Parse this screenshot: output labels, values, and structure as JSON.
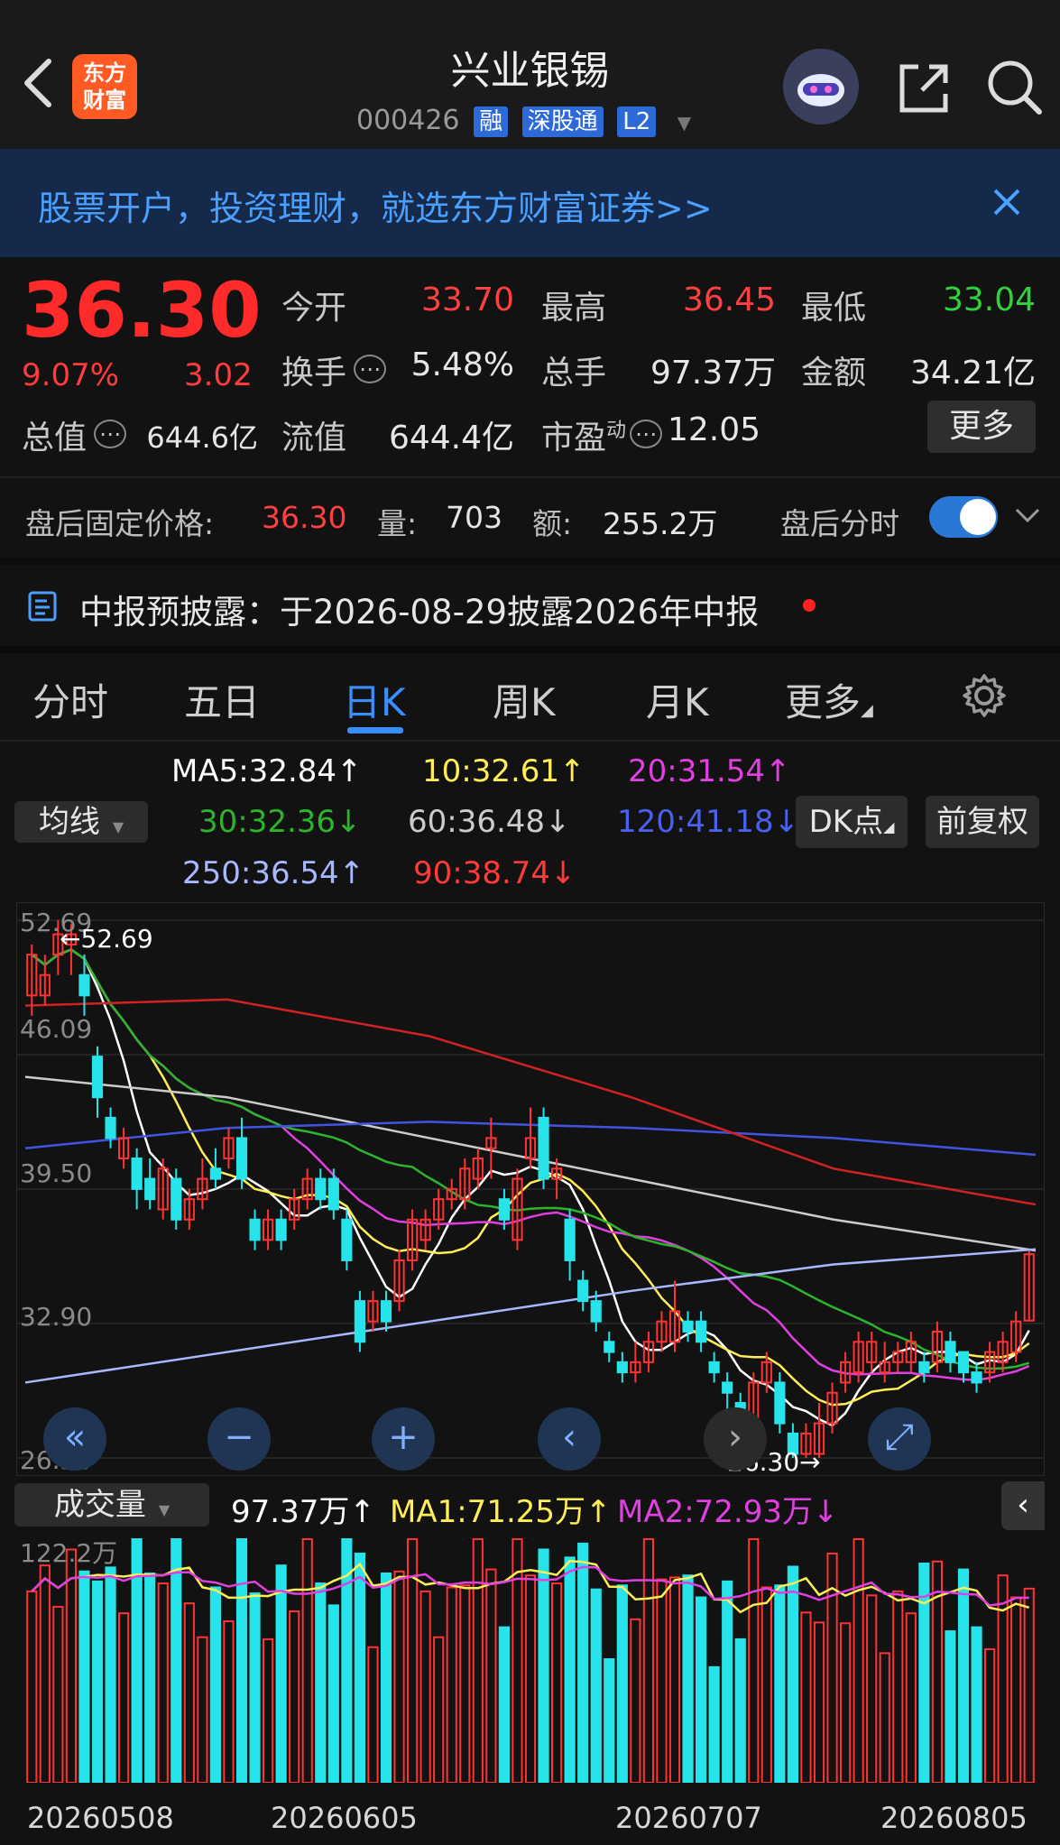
{
  "header": {
    "title": "兴业银锡",
    "code": "000426",
    "tags": [
      "融",
      "深股通",
      "L2"
    ],
    "logo_line1": "东方",
    "logo_line2": "财富"
  },
  "banner": {
    "text": "股票开户，投资理财，就选东方财富证券>>"
  },
  "quote": {
    "price": "36.30",
    "change_pct": "9.07%",
    "change": "3.02",
    "open_label": "今开",
    "open": "33.70",
    "high_label": "最高",
    "high": "36.45",
    "low_label": "最低",
    "low": "33.04",
    "turnover_label": "换手",
    "turnover": "5.48%",
    "volume_label": "总手",
    "volume": "97.37万",
    "amount_label": "金额",
    "amount": "34.21亿",
    "total_cap_label": "总值",
    "total_cap": "644.6亿",
    "float_cap_label": "流值",
    "float_cap": "644.4亿",
    "pe_label": "市盈",
    "pe_sup": "动",
    "pe": "12.05",
    "more": "更多"
  },
  "after_hours": {
    "price_label": "盘后固定价格:",
    "price": "36.30",
    "vol_label": "量:",
    "vol": "703",
    "amt_label": "额:",
    "amt": "255.2万",
    "toggle_label": "盘后分时"
  },
  "notice": {
    "text": "中报预披露：于2026-08-29披露2026年中报"
  },
  "tabs": [
    "分时",
    "五日",
    "日K",
    "周K",
    "月K",
    "更多"
  ],
  "ma": {
    "selector": "均线",
    "dk": "DK点",
    "fq": "前复权",
    "ma5": "MA5:32.84↑",
    "ma10": "10:32.61↑",
    "ma20": "20:31.54↑",
    "ma30": "30:32.36↓",
    "ma60": "60:36.48↓",
    "ma120": "120:41.18↓",
    "ma250": "250:36.54↑",
    "ma90": "90:38.74↓"
  },
  "colors": {
    "up": "#ff3333",
    "down": "#27e3ea",
    "ma5": "#ffffff",
    "ma10": "#ffee55",
    "ma20": "#e040e0",
    "ma30": "#2cb52c",
    "ma60": "#cccccc",
    "ma120": "#3f55e0",
    "ma250": "#a8b8ff",
    "ma90": "#d02222"
  },
  "volume_bar": {
    "selector": "成交量",
    "vol": "97.37万↑",
    "ma1": "MA1:71.25万↑",
    "ma2": "MA2:72.93万↓",
    "max_label": "122.2万"
  },
  "chart_data": {
    "type": "candlestick",
    "y_ticks": [
      "52.69",
      "46.09",
      "39.50",
      "32.90",
      "26.30"
    ],
    "ylim": [
      26.3,
      52.69
    ],
    "annotations": {
      "high": "52.69",
      "low": "26.30"
    },
    "dates": [
      "20260508",
      "20260605",
      "20260707",
      "20260805"
    ],
    "candles": [
      [
        49,
        51,
        48,
        51.5
      ],
      [
        49,
        50,
        48.5,
        51
      ],
      [
        51,
        52,
        50,
        52.69
      ],
      [
        51.5,
        52,
        50,
        52.5
      ],
      [
        50,
        49,
        48,
        51
      ],
      [
        46,
        44,
        43,
        46.5
      ],
      [
        43,
        42,
        41.5,
        43.5
      ],
      [
        41,
        42,
        40.5,
        42.5
      ],
      [
        41,
        39.5,
        38.5,
        41.5
      ],
      [
        40,
        39,
        38.5,
        41
      ],
      [
        38.5,
        40.5,
        38,
        41
      ],
      [
        40,
        38,
        37.5,
        40.5
      ],
      [
        38,
        39,
        37.5,
        39.5
      ],
      [
        39,
        40,
        38.5,
        41
      ],
      [
        40.5,
        40,
        39.5,
        41.5
      ],
      [
        41,
        42,
        40.5,
        42.5
      ],
      [
        42,
        40,
        39.5,
        43
      ],
      [
        38,
        37,
        36.5,
        38.5
      ],
      [
        37,
        38,
        36.5,
        38.5
      ],
      [
        38,
        37,
        36.5,
        38.5
      ],
      [
        38,
        39,
        37.5,
        39.5
      ],
      [
        39,
        40,
        38.5,
        40.5
      ],
      [
        40,
        39,
        38.5,
        40.5
      ],
      [
        40,
        38.5,
        38,
        40.5
      ],
      [
        38,
        36,
        35.5,
        38.5
      ],
      [
        34,
        32,
        31.5,
        34.5
      ],
      [
        33,
        34,
        32.5,
        34.5
      ],
      [
        34,
        33,
        32.5,
        34.5
      ],
      [
        34,
        36,
        33.5,
        36.5
      ],
      [
        36,
        38,
        35.5,
        38.5
      ],
      [
        37,
        38,
        36.5,
        38.5
      ],
      [
        38,
        39,
        37.5,
        39.5
      ],
      [
        39,
        39.5,
        38.5,
        40
      ],
      [
        39,
        40.5,
        38.5,
        41
      ],
      [
        40,
        41,
        39.5,
        41.5
      ],
      [
        41.5,
        42,
        40,
        43
      ],
      [
        39,
        38,
        37.5,
        39.5
      ],
      [
        37,
        40,
        36.5,
        40.5
      ],
      [
        41,
        42,
        40.5,
        43.5
      ],
      [
        43,
        40,
        39.5,
        43.5
      ],
      [
        40,
        40.5,
        39,
        41
      ],
      [
        38,
        36,
        35,
        38.5
      ],
      [
        35,
        34,
        33.5,
        35.5
      ],
      [
        34,
        33,
        32.5,
        34.5
      ],
      [
        32,
        31.5,
        31,
        32.5
      ],
      [
        31,
        30.5,
        30,
        31.5
      ],
      [
        30.5,
        31,
        30,
        32
      ],
      [
        31,
        32,
        30.5,
        32.5
      ],
      [
        32,
        33,
        31.5,
        33.5
      ],
      [
        32,
        33.5,
        31.5,
        35
      ],
      [
        33,
        32.5,
        32,
        33.5
      ],
      [
        33,
        32,
        31.5,
        33.5
      ],
      [
        31,
        30.5,
        30,
        31.5
      ],
      [
        30,
        29.5,
        28.5,
        30.5
      ],
      [
        29,
        28.5,
        28,
        29.5
      ],
      [
        28,
        30,
        27.8,
        30.5
      ],
      [
        30,
        31,
        29.5,
        31.5
      ],
      [
        30,
        28,
        27.5,
        30.5
      ],
      [
        27.5,
        26.5,
        26.3,
        28
      ],
      [
        26.5,
        27.5,
        26.3,
        28
      ],
      [
        26.5,
        28,
        26.3,
        29
      ],
      [
        28,
        29.5,
        27.5,
        30
      ],
      [
        30,
        31,
        29.5,
        31.5
      ],
      [
        30.5,
        32,
        30,
        32.5
      ],
      [
        31,
        32,
        30.5,
        32.5
      ],
      [
        30.5,
        31,
        30,
        32
      ],
      [
        31,
        31.5,
        30.5,
        32
      ],
      [
        31,
        32,
        30.5,
        32.5
      ],
      [
        31,
        30.5,
        30,
        31.5
      ],
      [
        31,
        32.5,
        30.5,
        33
      ],
      [
        32,
        31,
        30.5,
        32.5
      ],
      [
        31.5,
        30.5,
        30,
        31.5
      ],
      [
        30.5,
        30,
        29.5,
        31
      ],
      [
        30.5,
        31.5,
        30,
        32
      ],
      [
        31,
        32,
        30.5,
        32.5
      ],
      [
        31.5,
        33,
        31,
        33.5
      ],
      [
        33.04,
        36.3,
        33.04,
        36.45
      ]
    ],
    "volume_max": 122.2
  }
}
